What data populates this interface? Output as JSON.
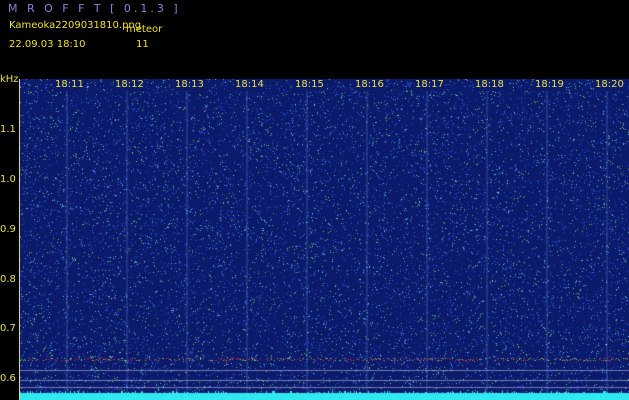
{
  "header": {
    "app_title": "M R O F F T  [ 0.1.3 ]",
    "file_name": "Kameoka2209031810.png",
    "meteor_label": "meteor",
    "date_time": "22.09.03  18:10",
    "meteor_count": "11"
  },
  "axis": {
    "unit": "kHz",
    "y_labels": [
      "1.1",
      "1.0",
      "0.9",
      "0.8",
      "0.7",
      "0.6"
    ],
    "time_labels": [
      "18:11",
      "18:12",
      "18:13",
      "18:14",
      "18:15",
      "18:16",
      "18:17",
      "18:18",
      "18:19",
      "18:20"
    ]
  },
  "colors": {
    "background": "#0b1a6a",
    "noise": "#2a55e0",
    "noise_light": "#6ac8c8",
    "noise_green": "#70c050",
    "label": "#e8e040",
    "title": "#7f86d8",
    "carrier": "#e02050",
    "bottom_band": "#30e8f0"
  }
}
